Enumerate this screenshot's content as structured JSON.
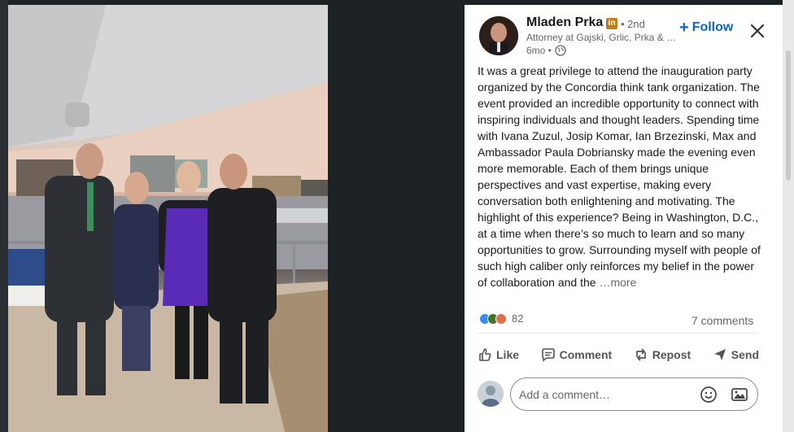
{
  "author": {
    "name": "Mladen Prka",
    "badge": "in",
    "degree": "• 2nd",
    "headline": "Attorney at Gajski, Grlic, Prka & Partners",
    "time": "6mo •",
    "follow_label": "Follow"
  },
  "post": {
    "text": "It was a great privilege to attend the inauguration party organized by the Concordia think tank organization. The event provided an incredible opportunity to connect with inspiring individuals and thought leaders. Spending time with Ivana Zuzul, Josip Komar, Ian Brzezinski, Max and Ambassador Paula Dobriansky made the evening even more memorable. Each of them brings unique perspectives and vast expertise, making every conversation both enlightening and motivating. The highlight of this experience? Being in Washington, D.C., at a time when there’s so much to learn and so many opportunities to grow. Surrounding myself with people of such high caliber only reinforces my belief in the power of collaboration and the",
    "more_label": "…more"
  },
  "social": {
    "reaction_count": "82",
    "comments_label": "7 comments",
    "reaction_icons": [
      "like-icon",
      "celebrate-icon",
      "love-icon"
    ]
  },
  "actions": {
    "like": "Like",
    "comment": "Comment",
    "repost": "Repost",
    "send": "Send"
  },
  "comment_box": {
    "placeholder": "Add a comment…"
  },
  "colors": {
    "accent": "#0a66c2",
    "badge": "#c37d16"
  }
}
